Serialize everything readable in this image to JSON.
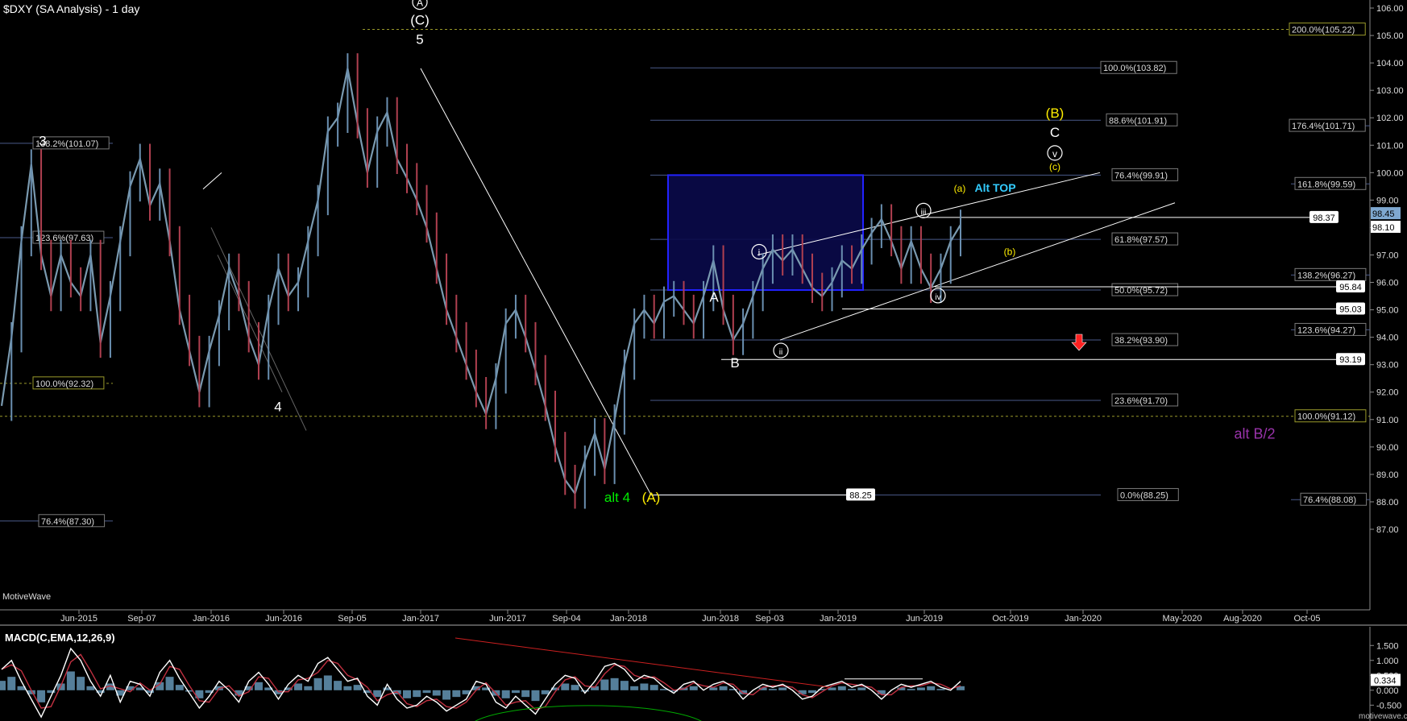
{
  "title": "$DXY (SA Analysis) - 1 day",
  "watermark": "MotiveWave",
  "credit": "motivewave.com",
  "chart_data": [
    {
      "type": "line",
      "title": "$DXY (SA Analysis) - 1 day",
      "x_ticks": [
        "Jun-2015",
        "Sep-07",
        "Jan-2016",
        "Jun-2016",
        "Sep-05",
        "Jan-2017",
        "Jun-2017",
        "Sep-04",
        "Jan-2018",
        "Jun-2018",
        "Sep-03",
        "Jan-2019",
        "Jun-2019",
        "Oct-2019",
        "Jan-2020",
        "May-2020",
        "Aug-2020",
        "Oct-05"
      ],
      "y_ticks": [
        87.0,
        88.0,
        89.0,
        90.0,
        91.0,
        92.0,
        93.0,
        94.0,
        95.0,
        96.0,
        97.0,
        98.0,
        99.0,
        100.0,
        101.0,
        102.0,
        103.0,
        104.0,
        105.0,
        106.0
      ],
      "ylim": [
        86.3,
        106.4
      ],
      "grid": false,
      "series": [
        {
          "values": [
            91.5,
            94.0,
            97.5,
            100.3,
            97.0,
            95.5,
            97.0,
            96.0,
            95.5,
            97.0,
            93.8,
            95.5,
            97.5,
            99.5,
            100.5,
            98.8,
            99.6,
            97.5,
            95.0,
            93.5,
            92.0,
            93.5,
            94.8,
            96.5,
            95.5,
            94.0,
            93.0,
            95.0,
            96.5,
            95.5,
            96.0,
            97.5,
            99.0,
            101.5,
            102.0,
            103.8,
            101.8,
            100.0,
            101.5,
            102.2,
            100.5,
            99.8,
            99.0,
            98.0,
            96.5,
            95.0,
            94.0,
            93.0,
            92.0,
            91.2,
            92.5,
            94.5,
            95.0,
            94.0,
            92.8,
            91.5,
            90.0,
            88.8,
            88.3,
            89.5,
            90.5,
            89.2,
            91.0,
            93.0,
            94.5,
            95.0,
            94.5,
            95.3,
            95.5,
            95.0,
            94.5,
            95.5,
            96.8,
            95.0,
            93.9,
            94.5,
            95.5,
            96.5,
            97.2,
            96.8,
            97.2,
            96.5,
            95.8,
            95.5,
            96.0,
            96.8,
            96.5,
            97.2,
            97.8,
            98.3,
            97.5,
            96.5,
            97.5,
            96.5,
            95.8,
            96.5,
            97.5,
            98.1
          ]
        }
      ],
      "fib_levels_center": [
        {
          "label": "200.0%(105.22)",
          "value": 105.22
        },
        {
          "label": "100.0%(103.82)",
          "value": 103.82
        },
        {
          "label": "88.6%(101.91)",
          "value": 101.91
        },
        {
          "label": "176.4%(101.71)",
          "value": 101.71
        },
        {
          "label": "76.4%(99.91)",
          "value": 99.91
        },
        {
          "label": "161.8%(99.59)",
          "value": 99.59
        },
        {
          "label": "61.8%(97.57)",
          "value": 97.57
        },
        {
          "label": "138.2%(96.27)",
          "value": 96.27
        },
        {
          "label": "50.0%(95.72)",
          "value": 95.72
        },
        {
          "label": "123.6%(94.27)",
          "value": 94.27
        },
        {
          "label": "38.2%(93.90)",
          "value": 93.9
        },
        {
          "label": "23.6%(91.70)",
          "value": 91.7
        },
        {
          "label": "100.0%(91.12)",
          "value": 91.12
        },
        {
          "label": "0.0%(88.25)",
          "value": 88.25
        },
        {
          "label": "76.4%(88.08)",
          "value": 88.08
        }
      ],
      "fib_levels_left": [
        {
          "label": "138.2%(101.07)",
          "value": 101.07
        },
        {
          "label": "123.6%(97.63)",
          "value": 97.63
        },
        {
          "label": "100.0%(92.32)",
          "value": 92.32
        },
        {
          "label": "76.4%(87.30)",
          "value": 87.3
        }
      ],
      "price_boxes": [
        {
          "label": "98.37",
          "value": 98.37
        },
        {
          "label": "95.84",
          "value": 95.84
        },
        {
          "label": "95.03",
          "value": 95.03
        },
        {
          "label": "93.19",
          "value": 93.19
        },
        {
          "label": "88.25",
          "value": 88.25
        }
      ],
      "axis_value_tags": [
        {
          "label": "98.45",
          "value": 98.45
        },
        {
          "label": "98.10",
          "value": 98.1
        }
      ],
      "annotations": [
        {
          "text": "3",
          "value": 101.0,
          "color": "#ffffff"
        },
        {
          "text": "4",
          "value": 91.3,
          "color": "#ffffff"
        },
        {
          "text": "5",
          "value": 104.7,
          "color": "#ffffff"
        },
        {
          "text": "(C)",
          "value": 105.4,
          "color": "#ffffff"
        },
        {
          "text": "A",
          "value": 106.1,
          "color": "#ffffff",
          "circled": true
        },
        {
          "text": "alt 4",
          "value": 88.0,
          "color": "#00ee00"
        },
        {
          "text": "(A)",
          "value": 88.0,
          "color": "#ffee00"
        },
        {
          "text": "A",
          "value": 95.3,
          "color": "#ffffff"
        },
        {
          "text": "B",
          "value": 92.9,
          "color": "#ffffff"
        },
        {
          "text": "i",
          "value": 97.0,
          "color": "#ffffff",
          "circled": true
        },
        {
          "text": "ii",
          "value": 93.4,
          "color": "#ffffff",
          "circled": true
        },
        {
          "text": "iii",
          "value": 98.5,
          "color": "#ffffff",
          "circled": true
        },
        {
          "text": "iv",
          "value": 95.4,
          "color": "#ffffff",
          "circled": true
        },
        {
          "text": "v",
          "value": 100.6,
          "color": "#ffffff",
          "circled": true
        },
        {
          "text": "C",
          "value": 101.3,
          "color": "#ffffff"
        },
        {
          "text": "(B)",
          "value": 102.0,
          "color": "#ffee00"
        },
        {
          "text": "(a)",
          "value": 99.3,
          "color": "#ffee00"
        },
        {
          "text": "(b)",
          "value": 97.0,
          "color": "#ffee00"
        },
        {
          "text": "(c)",
          "value": 100.1,
          "color": "#ffee00"
        },
        {
          "text": "Alt TOP",
          "value": 99.3,
          "color": "#33ccff"
        },
        {
          "text": "alt B/2",
          "value": 90.3,
          "color": "#9933aa"
        }
      ]
    },
    {
      "type": "line",
      "title": "MACD(C,EMA,12,26,9)",
      "y_ticks": [
        1.5,
        1.0,
        0.5,
        0.0,
        -0.5
      ],
      "ylim": [
        -0.95,
        1.75
      ],
      "tags": [
        {
          "label": "0.334",
          "value": 0.334
        }
      ],
      "series": [
        {
          "values": [
            0.7,
            1.0,
            0.3,
            -0.3,
            -0.9,
            -0.2,
            0.5,
            1.4,
            1.0,
            0.3,
            -0.2,
            0.5,
            -0.4,
            0.3,
            0.2,
            -0.2,
            0.6,
            1.0,
            0.4,
            -0.1,
            -0.6,
            -0.2,
            0.3,
            0.0,
            -0.4,
            0.3,
            0.6,
            0.2,
            -0.3,
            0.2,
            0.5,
            0.3,
            0.9,
            1.1,
            0.7,
            0.3,
            0.4,
            -0.2,
            -0.5,
            0.2,
            -0.3,
            -0.6,
            -0.5,
            -0.2,
            -0.4,
            -0.7,
            -0.5,
            -0.3,
            0.3,
            0.2,
            -0.4,
            -0.6,
            -0.2,
            -0.5,
            -0.8,
            -0.3,
            0.2,
            0.5,
            0.4,
            -0.1,
            0.3,
            0.8,
            0.9,
            0.7,
            0.3,
            0.5,
            0.4,
            0.1,
            -0.1,
            0.2,
            0.3,
            0.0,
            0.2,
            0.3,
            0.1,
            -0.3,
            0.0,
            0.2,
            0.1,
            0.2,
            0.0,
            -0.3,
            -0.2,
            0.1,
            0.2,
            0.3,
            0.1,
            0.2,
            0.0,
            -0.3,
            0.0,
            0.2,
            0.1,
            0.2,
            0.3,
            0.1,
            0.0,
            0.3
          ]
        }
      ]
    }
  ]
}
